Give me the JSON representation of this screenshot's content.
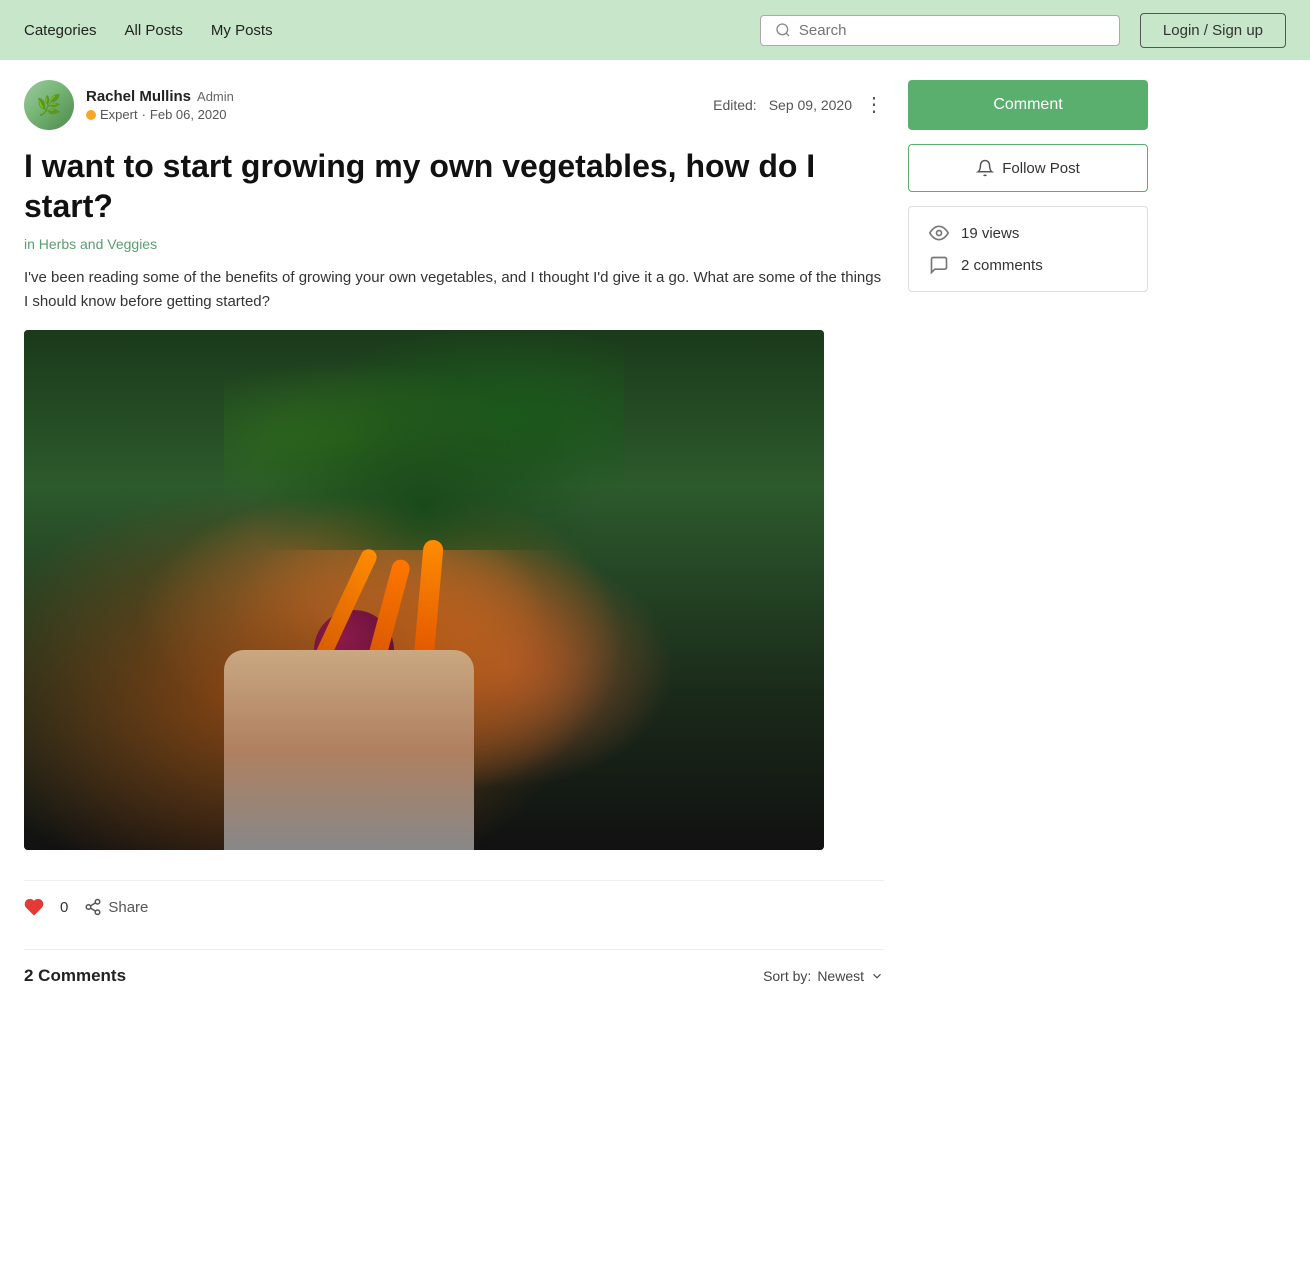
{
  "nav": {
    "links": [
      {
        "label": "Categories",
        "id": "categories"
      },
      {
        "label": "All Posts",
        "id": "all-posts"
      },
      {
        "label": "My Posts",
        "id": "my-posts"
      }
    ],
    "search_placeholder": "Search",
    "login_label": "Login / Sign up"
  },
  "author": {
    "name": "Rachel Mullins",
    "role": "Admin",
    "badge": "Expert",
    "date": "Feb 06, 2020",
    "edited": "Edited:",
    "edited_date": "Sep 09, 2020"
  },
  "post": {
    "title": "I want to start growing my own vegetables, how do I start?",
    "category": "in Herbs and Veggies",
    "body": "I've been reading some of the benefits of growing your own vegetables, and I thought I'd give it a go. What are some of the things I should know before getting started?",
    "likes": "0",
    "share_label": "Share",
    "comments_count": "2 Comments",
    "sort_label": "Sort by:",
    "sort_value": "Newest"
  },
  "sidebar": {
    "comment_label": "Comment",
    "follow_label": "Follow Post",
    "views_count": "19 views",
    "comments_count": "2 comments"
  }
}
